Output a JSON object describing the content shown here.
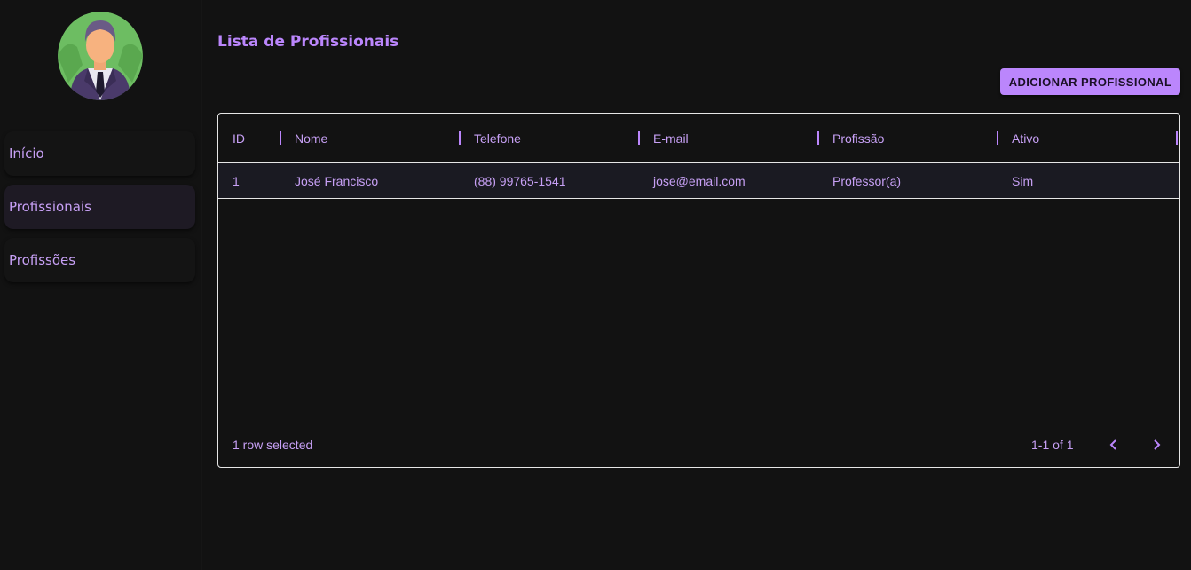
{
  "sidebar": {
    "avatar_icon": "businessman-avatar",
    "items": [
      {
        "label": "Início",
        "active": false
      },
      {
        "label": "Profissionais",
        "active": true
      },
      {
        "label": "Profissões",
        "active": false
      }
    ]
  },
  "main": {
    "title": "Lista de Profissionais",
    "add_button_label": "ADICIONAR PROFISSIONAL"
  },
  "table": {
    "columns": [
      "ID",
      "Nome",
      "Telefone",
      "E-mail",
      "Profissão",
      "Ativo"
    ],
    "rows": [
      [
        "1",
        "José Francisco",
        "(88) 99765-1541",
        "jose@email.com",
        "Professor(a)",
        "Sim"
      ]
    ],
    "footer": {
      "selection_text": "1 row selected",
      "pagination_text": "1-1 of 1"
    }
  },
  "colors": {
    "accent": "#bb86fc",
    "background": "#121212",
    "border": "#e6e6e6"
  },
  "icons": {
    "prev": "chevron-left-icon",
    "next": "chevron-right-icon"
  }
}
